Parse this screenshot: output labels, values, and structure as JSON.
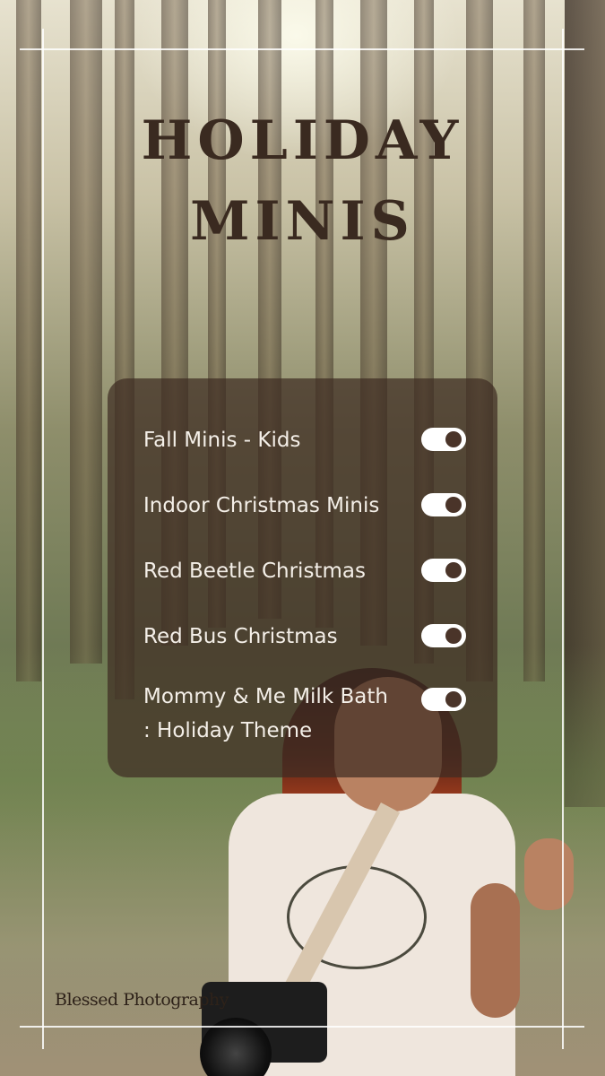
{
  "title": {
    "line1": "HOLIDAY",
    "line2": "MINIS"
  },
  "menu": {
    "items": [
      {
        "label": "Fall Minis - Kids",
        "enabled": true
      },
      {
        "label": "Indoor Christmas Minis",
        "enabled": true
      },
      {
        "label": "Red Beetle Christmas",
        "enabled": true
      },
      {
        "label": "Red Bus Christmas",
        "enabled": true
      },
      {
        "label": "Mommy & Me Milk Bath : Holiday Theme",
        "enabled": true
      }
    ]
  },
  "footer": {
    "brand": "Blessed Photography"
  },
  "colors": {
    "title": "#3a2a20",
    "panel": "#3e2c22",
    "toggle_on": "#ffffff",
    "knob": "#4a3429",
    "label": "#f4efe8"
  }
}
